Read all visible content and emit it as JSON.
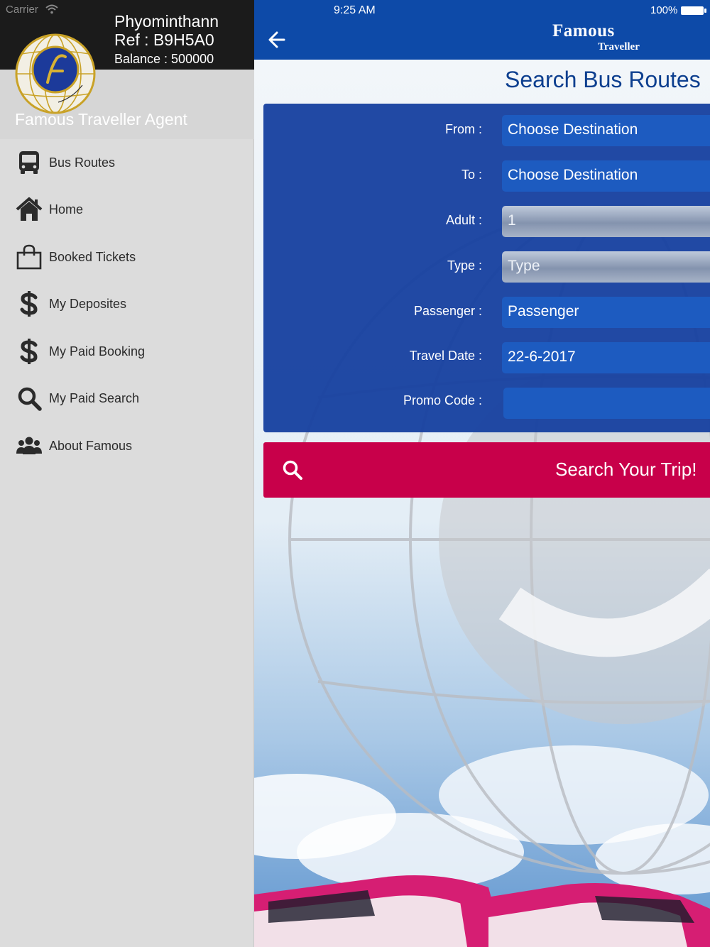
{
  "status_bar": {
    "carrier": "Carrier",
    "time": "9:25 AM",
    "battery": "100%"
  },
  "user": {
    "name": "Phyominthann",
    "ref": "Ref : B9H5A0",
    "balance": "Balance : 500000",
    "agent_title": "Famous Traveller Agent"
  },
  "sidebar": {
    "items": [
      {
        "label": "Bus Routes",
        "icon": "bus-icon"
      },
      {
        "label": "Home",
        "icon": "home-icon"
      },
      {
        "label": "Booked Tickets",
        "icon": "shopping-bag-icon"
      },
      {
        "label": "My Deposites",
        "icon": "dollar-icon"
      },
      {
        "label": "My Paid Booking",
        "icon": "dollar-icon"
      },
      {
        "label": "My Paid Search",
        "icon": "magnifier-icon"
      },
      {
        "label": "About Famous",
        "icon": "people-icon"
      }
    ]
  },
  "header": {
    "brand_line1": "Famous",
    "brand_line2": "Traveller"
  },
  "page": {
    "title": "Search Bus Routes"
  },
  "form": {
    "from": {
      "label": "From :",
      "value": "Choose Destination"
    },
    "to": {
      "label": "To :",
      "value": "Choose Destination"
    },
    "adult": {
      "label": "Adult :",
      "value": "1"
    },
    "type": {
      "label": "Type :",
      "value": "Type"
    },
    "passenger": {
      "label": "Passenger :",
      "value": "Passenger"
    },
    "travel_date": {
      "label": "Travel Date :",
      "value": "22-6-2017"
    },
    "promo_code": {
      "label": "Promo Code :",
      "value": ""
    }
  },
  "search_button": {
    "label": "Search Your Trip!"
  },
  "colors": {
    "navbar": "#0d4aa8",
    "form_card": "#1842a0",
    "search_button": "#c8004a",
    "title": "#0d3f8f",
    "sidebar_bg": "#dcdcdc"
  }
}
